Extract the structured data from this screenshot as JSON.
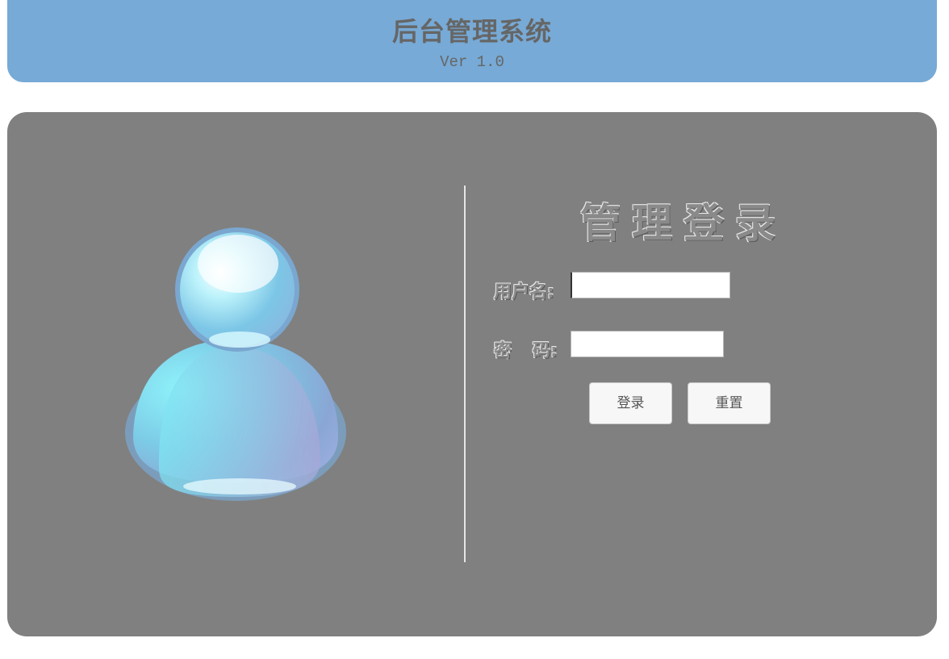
{
  "header": {
    "title": "后台管理系统",
    "version": "Ver 1.0",
    "background_color": "#77aad6"
  },
  "login": {
    "title": "管理登录",
    "username_label": "用户名:",
    "password_label_1": "密",
    "password_label_2": "码:",
    "username_value": "",
    "password_value": "",
    "login_button": "登录",
    "reset_button": "重置",
    "panel_color": "#808080"
  },
  "avatar": {
    "icon": "user-avatar-icon"
  }
}
